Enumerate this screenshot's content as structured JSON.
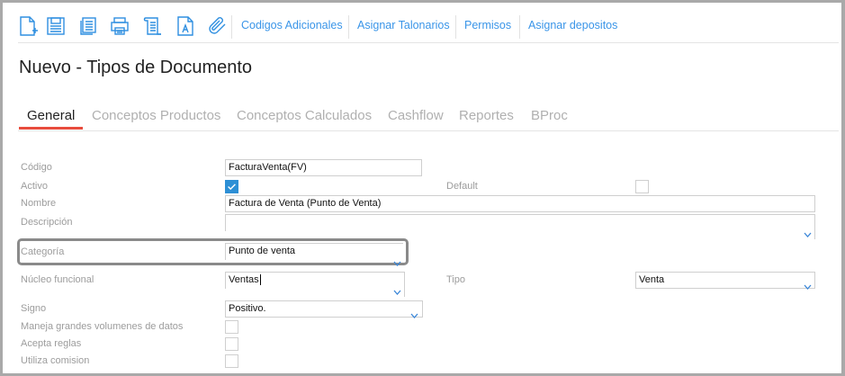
{
  "toolbar": {
    "icons": [
      "new-document-icon",
      "save-icon",
      "copy-icon",
      "print-icon",
      "scroll-report-icon",
      "text-document-icon",
      "attachment-icon"
    ],
    "links": [
      "Codigos Adicionales",
      "Asignar Talonarios",
      "Permisos",
      "Asignar depositos"
    ]
  },
  "page_title": "Nuevo - Tipos de Documento",
  "tabs": [
    {
      "label": "General",
      "active": true
    },
    {
      "label": "Conceptos Productos"
    },
    {
      "label": "Conceptos Calculados"
    },
    {
      "label": "Cashflow"
    },
    {
      "label": "Reportes"
    },
    {
      "label": "BProc"
    }
  ],
  "accent_color": "#e84c3d",
  "form": {
    "codigo": {
      "label": "Código",
      "value": "FacturaVenta(FV)"
    },
    "activo": {
      "label": "Activo",
      "checked": true
    },
    "default": {
      "label": "Default",
      "checked": false
    },
    "nombre": {
      "label": "Nombre",
      "value": "Factura de Venta (Punto de Venta)"
    },
    "descripcion": {
      "label": "Descripción",
      "value": ""
    },
    "categoria": {
      "label": "Categoría",
      "value": "Punto de venta"
    },
    "nucleo": {
      "label": "Núcleo funcional",
      "value": "Ventas"
    },
    "tipo": {
      "label": "Tipo",
      "value": "Venta"
    },
    "signo": {
      "label": "Signo",
      "value": "Positivo."
    },
    "maneja": {
      "label": "Maneja grandes volumenes de datos",
      "checked": false
    },
    "acepta": {
      "label": "Acepta reglas",
      "checked": false
    },
    "utiliza": {
      "label": "Utiliza comision",
      "checked": false
    }
  }
}
